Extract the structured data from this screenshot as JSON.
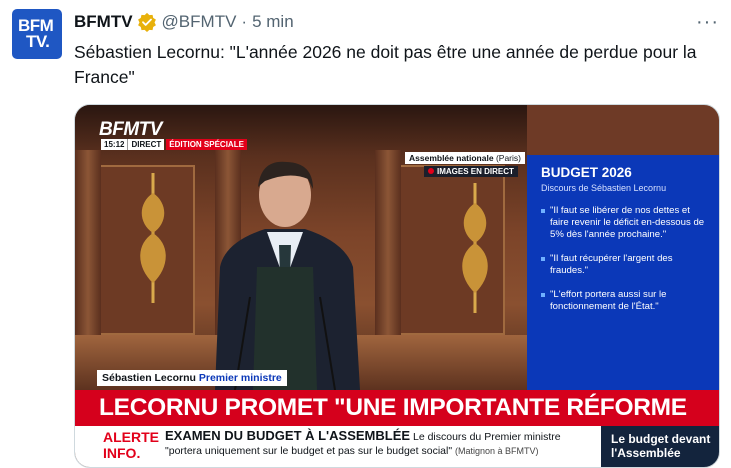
{
  "tweet": {
    "avatar_line1": "BFM",
    "avatar_line2": "TV.",
    "name": "BFMTV",
    "handle": "@BFMTV",
    "separator": "·",
    "time": "5 min",
    "more": "···",
    "text": "Sébastien Lecornu: \"L'année 2026 ne doit pas être une année de perdue pour la France\""
  },
  "broadcast": {
    "logo": "BFMTV",
    "clock": "15:12",
    "direct": "DIRECT",
    "special": "ÉDITION SPÉCIALE",
    "location": "Assemblée nationale",
    "location_detail": "(Paris)",
    "images_live": "IMAGES EN DIRECT",
    "side_title": "BUDGET 2026",
    "side_subtitle": "Discours de Sébastien Lecornu",
    "quotes": [
      "\"Il faut se libérer de nos dettes et faire revenir le déficit en-dessous de 5% dès l'année prochaine.\"",
      "\"Il faut récupérer l'argent des fraudes.\"",
      "\"L'effort portera aussi sur le fonctionnement de l'État.\""
    ],
    "speaker_name": "Sébastien Lecornu",
    "speaker_role": "Premier ministre",
    "headline": "LECORNU PROMET \"UNE IMPORTANTE RÉFORME DE L'ÉTAT\"",
    "alert_line1": "ALERTE",
    "alert_line2": "INFO.",
    "ticker_bold": "EXAMEN DU BUDGET À L'ASSEMBLÉE",
    "ticker_text": "Le discours du Premier ministre \"portera uniquement sur le budget et pas sur le budget social\"",
    "ticker_source": "(Matignon à BFMTV)",
    "promo": "Le budget devant l'Assemblée"
  },
  "colors": {
    "brand_blue": "#1f57c3",
    "alert_red": "#d5001c",
    "side_blue": "#0b38b8",
    "verified_gold": "#e8b10b"
  }
}
